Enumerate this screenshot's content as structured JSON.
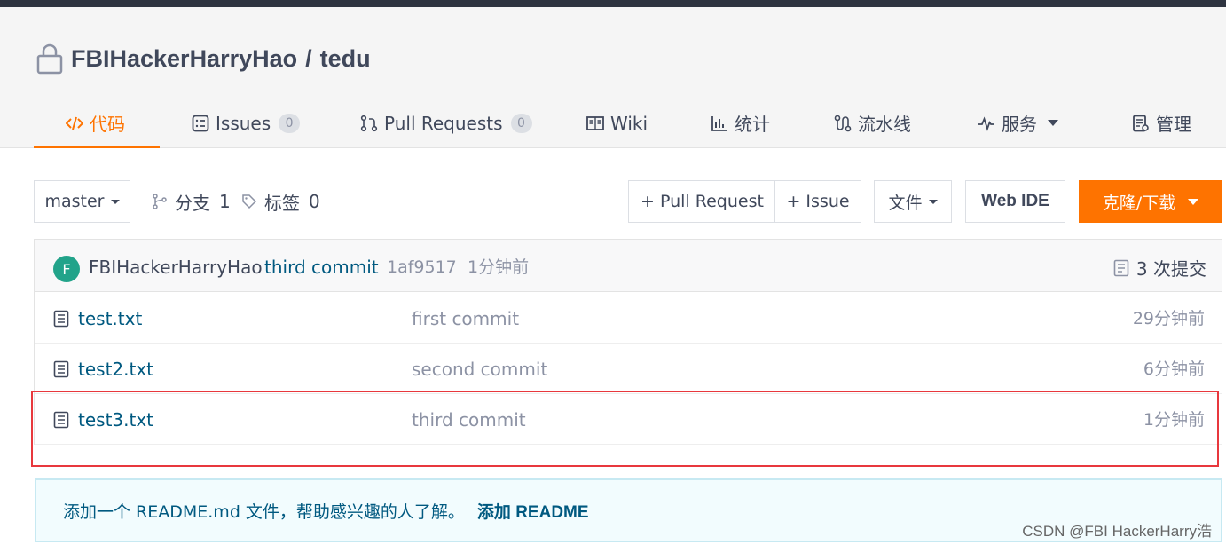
{
  "repo": {
    "owner": "FBIHackerHarryHao",
    "separator": "/",
    "name": "tedu"
  },
  "tabs": [
    {
      "label": "代码",
      "icon": "code-icon",
      "active": true
    },
    {
      "label": "Issues",
      "icon": "issues-icon",
      "count": "0"
    },
    {
      "label": "Pull Requests",
      "icon": "pull-request-icon",
      "count": "0"
    },
    {
      "label": "Wiki",
      "icon": "book-icon"
    },
    {
      "label": "统计",
      "icon": "bar-chart-icon"
    },
    {
      "label": "流水线",
      "icon": "pipeline-icon"
    },
    {
      "label": "服务",
      "icon": "pulse-icon",
      "dropdown": true
    },
    {
      "label": "管理",
      "icon": "settings-doc-icon"
    }
  ],
  "toolbar": {
    "branch": "master",
    "branches_label": "分支",
    "branches_count": "1",
    "tags_label": "标签",
    "tags_count": "0",
    "pull_request_button": "+ Pull Request",
    "issue_button": "+ Issue",
    "file_button": "文件",
    "web_ide_button": "Web IDE",
    "clone_button": "克隆/下载"
  },
  "last_commit": {
    "avatar_letter": "F",
    "author": "FBIHackerHarryHao",
    "message": "third commit",
    "sha": "1af9517",
    "time": "1分钟前",
    "commit_count": "3 次提交"
  },
  "files": [
    {
      "name": "test.txt",
      "message": "first commit",
      "time": "29分钟前"
    },
    {
      "name": "test2.txt",
      "message": "second commit",
      "time": "6分钟前"
    },
    {
      "name": "test3.txt",
      "message": "third commit",
      "time": "1分钟前"
    }
  ],
  "readme_notice": {
    "text": "添加一个 README.md 文件，帮助感兴趣的人了解。",
    "link": "添加 README"
  },
  "watermark": "CSDN @FBI HackerHarry浩",
  "colors": {
    "accent": "#fe7300",
    "link": "#005980",
    "highlight_border": "#e8383d",
    "avatar": "#22a38a"
  }
}
